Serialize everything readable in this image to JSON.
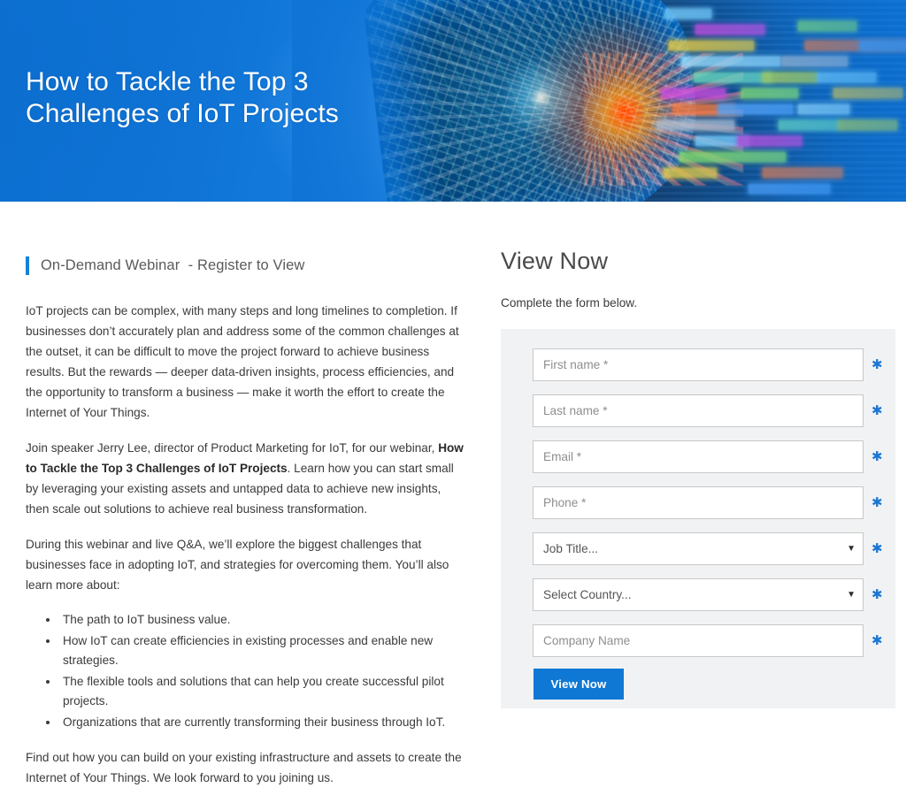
{
  "hero": {
    "title": "How to Tackle the Top 3 Challenges of IoT Projects",
    "background_color": "#0f74d6",
    "image_alt": "fisheye-cityscape-lightburst"
  },
  "left": {
    "eyebrow": "On-Demand Webinar  - Register to View",
    "eyebrow_accent_color": "#1482d8",
    "paragraph_1": "IoT projects can be complex, with many steps and long timelines to completion. If businesses don’t accurately plan and address some of the common challenges at the outset, it can be difficult to move the project forward to achieve business results. But the rewards — deeper data-driven insights, process efficiencies, and the opportunity to transform a business — make it worth the effort to create the Internet of Your Things.",
    "paragraph_2_part1": "Join speaker Jerry Lee, director of Product Marketing for IoT, for our webinar, ",
    "paragraph_2_bold": "How to Tackle the Top 3 Challenges of IoT Projects",
    "paragraph_2_part2": ". Learn how you can start small by leveraging your existing assets and untapped data to achieve new insights, then scale out solutions to achieve real business transformation.",
    "paragraph_3": "During this webinar and live Q&A, we’ll explore the biggest challenges that businesses face in adopting IoT, and strategies for overcoming them. You’ll also learn more about:",
    "bullets": [
      "The path to IoT business value.",
      "How IoT can create efficiencies in existing processes and enable new strategies.",
      "The flexible tools and solutions that can help you create successful pilot projects.",
      "Organizations that are currently transforming their business through IoT."
    ],
    "paragraph_4": "Find out how you can build on your existing infrastructure and assets to create the Internet of Your Things. We look forward to you joining us."
  },
  "form": {
    "title": "View Now",
    "subtitle": "Complete the form below.",
    "panel_background": "#f1f2f4",
    "required_marker": "✱",
    "required_marker_color": "#1b76d2",
    "fields": [
      {
        "name": "first-name",
        "type": "text",
        "placeholder": "First name *",
        "value": "",
        "required": true
      },
      {
        "name": "last-name",
        "type": "text",
        "placeholder": "Last name *",
        "value": "",
        "required": true
      },
      {
        "name": "email",
        "type": "text",
        "placeholder": "Email *",
        "value": "",
        "required": true
      },
      {
        "name": "phone",
        "type": "text",
        "placeholder": "Phone *",
        "value": "",
        "required": true
      },
      {
        "name": "job-title",
        "type": "select",
        "placeholder": "Job Title...",
        "value": "Job Title...",
        "required": true
      },
      {
        "name": "country",
        "type": "select",
        "placeholder": "Select Country...",
        "value": "Select Country...",
        "required": true
      },
      {
        "name": "company-name",
        "type": "text",
        "placeholder": "Company Name",
        "value": "",
        "required": true
      }
    ],
    "submit_label": "View Now",
    "submit_color": "#0f78d4",
    "caret_glyph": "▼"
  }
}
